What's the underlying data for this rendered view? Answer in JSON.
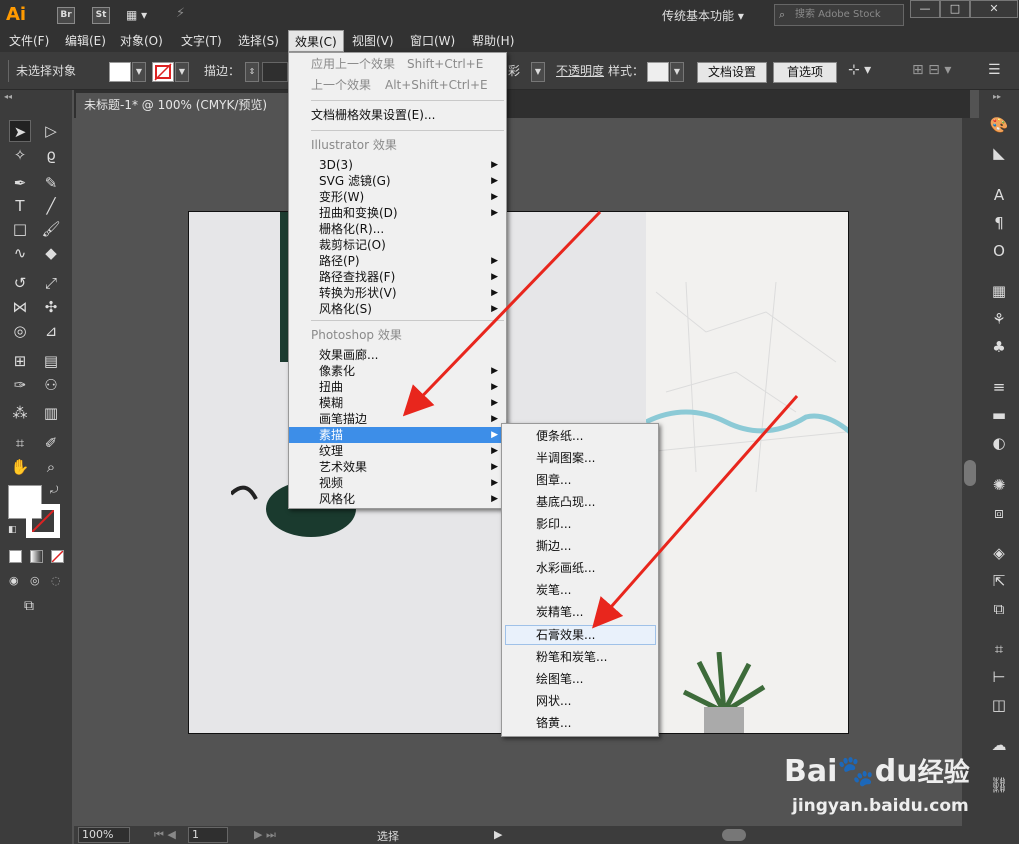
{
  "titlebar": {
    "app_logo": "Ai",
    "br": "Br",
    "st": "St",
    "workspace": "传统基本功能 ▾",
    "search_placeholder": "搜索 Adobe Stock",
    "min": "—",
    "max": "□",
    "close": "✕"
  },
  "menubar": [
    "文件(F)",
    "编辑(E)",
    "对象(O)",
    "文字(T)",
    "选择(S)",
    "效果(C)",
    "视图(V)",
    "窗口(W)",
    "帮助(H)"
  ],
  "control": {
    "selection": "未选择对象",
    "stroke_label": "描边：",
    "opacity": "不透明度",
    "style": "样式：",
    "doc_settings": "文档设置",
    "preferences": "首选项",
    "mode_fragment": "彩"
  },
  "doc_tab": "未标题-1* @ 100% (CMYK/预览)",
  "effect_menu": {
    "apply_last": "应用上一个效果",
    "apply_last_sc": "Shift+Ctrl+E",
    "last": "上一个效果",
    "last_sc": "Alt+Shift+Ctrl+E",
    "raster_settings": "文档栅格效果设置(E)...",
    "ai_header": "Illustrator 效果",
    "ai_items": [
      "3D(3)",
      "SVG 滤镜(G)",
      "变形(W)",
      "扭曲和变换(D)",
      "栅格化(R)...",
      "裁剪标记(O)",
      "路径(P)",
      "路径查找器(F)",
      "转换为形状(V)",
      "风格化(S)"
    ],
    "ps_header": "Photoshop 效果",
    "ps_items": [
      "效果画廊...",
      "像素化",
      "扭曲",
      "模糊",
      "画笔描边",
      "素描",
      "纹理",
      "艺术效果",
      "视频",
      "风格化"
    ]
  },
  "sketch_submenu": [
    "便条纸...",
    "半调图案...",
    "图章...",
    "基底凸现...",
    "影印...",
    "撕边...",
    "水彩画纸...",
    "炭笔...",
    "炭精笔...",
    "石膏效果...",
    "粉笔和炭笔...",
    "绘图笔...",
    "网状...",
    "铬黄..."
  ],
  "status": {
    "zoom": "100%",
    "page": "1",
    "mode": "选择"
  },
  "watermark": {
    "brand": "Bai",
    "brand2": "du",
    "brand3": "经验",
    "url": "jingyan.baidu.com"
  },
  "colors": {
    "highlight": "#3d8ee8",
    "arrow": "#e8261d",
    "menu_bg": "#f0f0f0"
  }
}
